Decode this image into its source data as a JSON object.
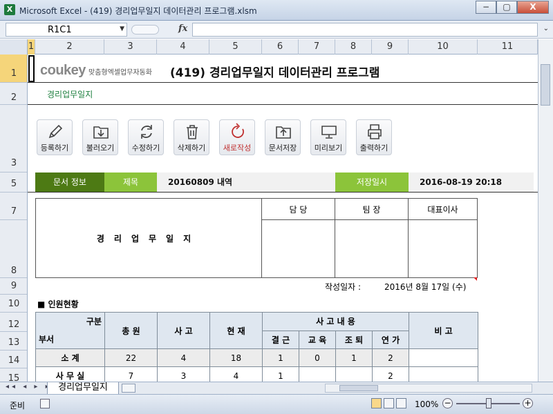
{
  "window": {
    "title": "Microsoft Excel - (419) 경리업무일지 데이터관리 프로그램.xlsm",
    "app_icon": "X",
    "controls": [
      "−",
      "▢",
      "X"
    ]
  },
  "formula_bar": {
    "name_box": "R1C1",
    "fx": "fx",
    "formula": ""
  },
  "columns": [
    "1",
    "2",
    "3",
    "4",
    "5",
    "6",
    "7",
    "8",
    "9",
    "10",
    "11"
  ],
  "rows": [
    "1",
    "2",
    "3",
    "5",
    "7",
    "8",
    "9",
    "10",
    "12",
    "13",
    "14",
    "15"
  ],
  "header": {
    "logo": "coukey",
    "logo_tagline": "맞춤형엑셀업무자동화",
    "title": "(419) 경리업무일지 데이터관리 프로그램",
    "subtitle": "경리업무일지"
  },
  "toolbar": [
    {
      "label": "등록하기",
      "icon": "pencil-icon"
    },
    {
      "label": "불러오기",
      "icon": "load-icon"
    },
    {
      "label": "수정하기",
      "icon": "refresh-icon"
    },
    {
      "label": "삭제하기",
      "icon": "trash-icon"
    },
    {
      "label": "새로작성",
      "icon": "new-icon"
    },
    {
      "label": "문서저장",
      "icon": "folder-save-icon"
    },
    {
      "label": "미리보기",
      "icon": "monitor-icon"
    },
    {
      "label": "출력하기",
      "icon": "printer-icon"
    }
  ],
  "info_bar": {
    "doc_info": "문서 정보",
    "title_label": "제목",
    "title_value": "20160809 내역",
    "saved_label": "저장일시",
    "saved_value": "2016-08-19 20:18"
  },
  "document": {
    "big_title": "경리업무일지",
    "approvals": [
      "담 당",
      "팀 장",
      "대표이사"
    ],
    "date_label": "작성일자 :",
    "date_value": "2016년 8월 17일 (수)",
    "section": "■ 인원현황"
  },
  "staff_table": {
    "corner_top": "구분",
    "corner_bottom": "부서",
    "headers": [
      "총 원",
      "사 고",
      "현 재"
    ],
    "group_header": "사 고 내 용",
    "sub_headers": [
      "결 근",
      "교 육",
      "조 퇴",
      "연 가"
    ],
    "remarks": "비 고",
    "rows": [
      {
        "dept": "소 계",
        "total": "22",
        "absent": "4",
        "present": "18",
        "d1": "1",
        "d2": "0",
        "d3": "1",
        "d4": "2"
      },
      {
        "dept": "사 무 실",
        "total": "7",
        "absent": "3",
        "present": "4",
        "d1": "1",
        "d2": "",
        "d3": "",
        "d4": "2"
      }
    ]
  },
  "sheet_tabs": {
    "active": "경리업무일지",
    "nav": "◂◂ ◂ ▸ ▸▸"
  },
  "status": {
    "ready": "준비",
    "zoom": "100%"
  },
  "colors": {
    "green_dark": "#4d7a14",
    "green_light": "#8cc43a",
    "accent_red": "#c03030"
  }
}
